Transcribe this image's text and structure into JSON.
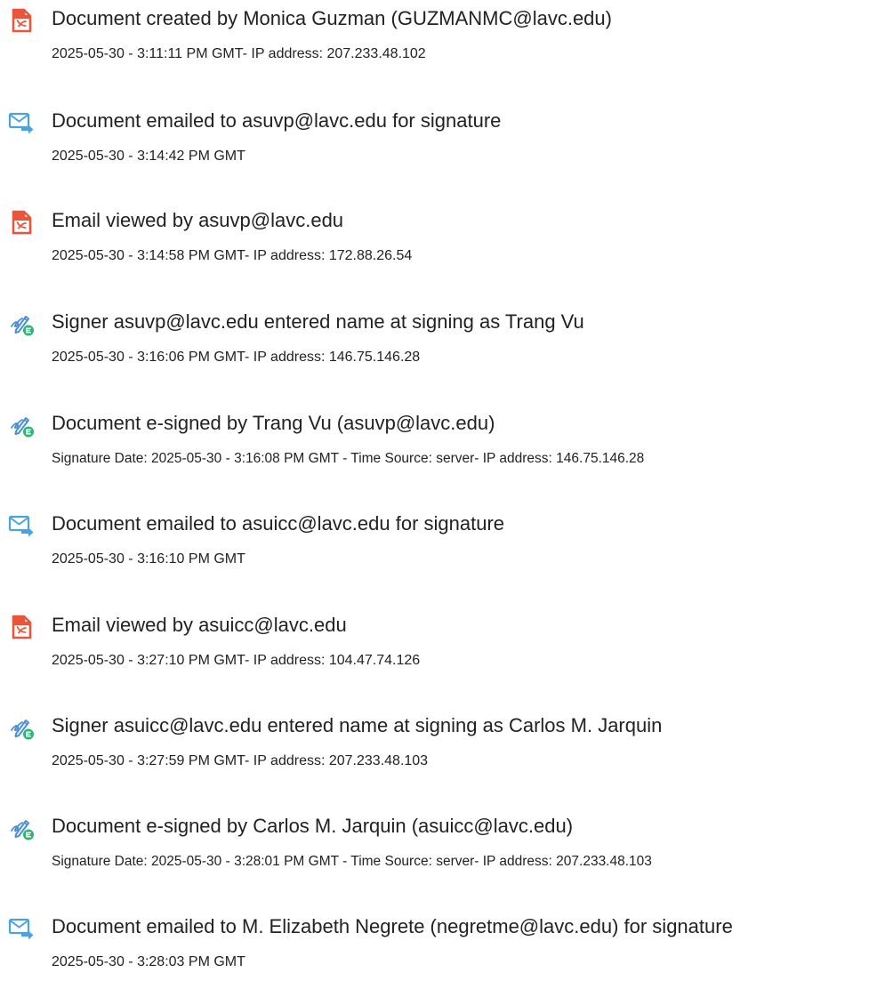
{
  "colors": {
    "document_icon": "#e8553b",
    "email_icon": "#4aa3df",
    "sign_icon": "#4a8fd6",
    "sign_badge": "#2bb673"
  },
  "entries": [
    {
      "icon": "document-icon",
      "title": "Document created by Monica Guzman (GUZMANMC@lavc.edu)",
      "meta": "2025-05-30 - 3:11:11 PM GMT- IP address: 207.233.48.102"
    },
    {
      "icon": "email-send-icon",
      "title": "Document emailed to asuvp@lavc.edu for signature",
      "meta": "2025-05-30 - 3:14:42 PM GMT"
    },
    {
      "icon": "document-icon",
      "title": "Email viewed by asuvp@lavc.edu",
      "meta": "2025-05-30 - 3:14:58 PM GMT- IP address: 172.88.26.54"
    },
    {
      "icon": "esign-pen-icon",
      "title": "Signer asuvp@lavc.edu entered name at signing as Trang Vu",
      "meta": "2025-05-30 - 3:16:06 PM GMT- IP address: 146.75.146.28"
    },
    {
      "icon": "esign-pen-icon",
      "title": "Document e-signed by Trang Vu (asuvp@lavc.edu)",
      "meta": "Signature Date: 2025-05-30 - 3:16:08 PM GMT - Time Source: server- IP address: 146.75.146.28"
    },
    {
      "icon": "email-send-icon",
      "title": "Document emailed to asuicc@lavc.edu for signature",
      "meta": "2025-05-30 - 3:16:10 PM GMT"
    },
    {
      "icon": "document-icon",
      "title": "Email viewed by asuicc@lavc.edu",
      "meta": "2025-05-30 - 3:27:10 PM GMT- IP address: 104.47.74.126"
    },
    {
      "icon": "esign-pen-icon",
      "title": "Signer asuicc@lavc.edu entered name at signing as Carlos M. Jarquin",
      "meta": "2025-05-30 - 3:27:59 PM GMT- IP address: 207.233.48.103"
    },
    {
      "icon": "esign-pen-icon",
      "title": "Document e-signed by Carlos M. Jarquin (asuicc@lavc.edu)",
      "meta": "Signature Date: 2025-05-30 - 3:28:01 PM GMT - Time Source: server- IP address: 207.233.48.103"
    },
    {
      "icon": "email-send-icon",
      "title": "Document emailed to M. Elizabeth Negrete (negretme@lavc.edu) for signature",
      "meta": "2025-05-30 - 3:28:03 PM GMT"
    }
  ]
}
